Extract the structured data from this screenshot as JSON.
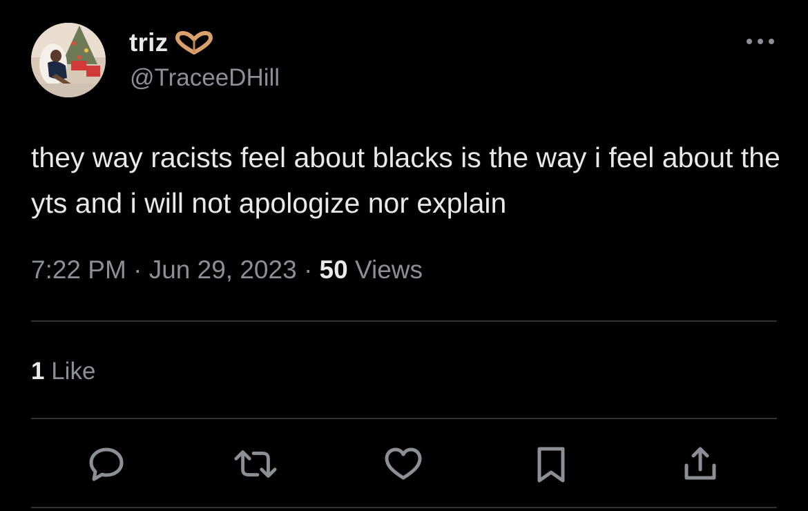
{
  "author": {
    "display_name": "triz",
    "handle": "@TraceeDHill",
    "name_emoji": "heart-hands-icon",
    "avatar": "avatar"
  },
  "tweet": {
    "text": "they way racists feel about blacks is the way i feel about the yts and i will not apologize nor explain",
    "time": "7:22 PM",
    "separator": "·",
    "date": "Jun 29, 2023",
    "views_count": "50",
    "views_label": "Views"
  },
  "engagement": {
    "likes_count": "1",
    "likes_label": "Like"
  },
  "actions": [
    {
      "name": "reply",
      "icon": "reply-icon"
    },
    {
      "name": "retweet",
      "icon": "retweet-icon"
    },
    {
      "name": "like",
      "icon": "heart-icon"
    },
    {
      "name": "bookmark",
      "icon": "bookmark-icon"
    },
    {
      "name": "share",
      "icon": "share-icon"
    }
  ],
  "colors": {
    "background": "#000000",
    "primary_text": "#e7e9ea",
    "secondary_text": "#8b9096",
    "divider": "#2f3336",
    "icon": "#8b9096"
  }
}
